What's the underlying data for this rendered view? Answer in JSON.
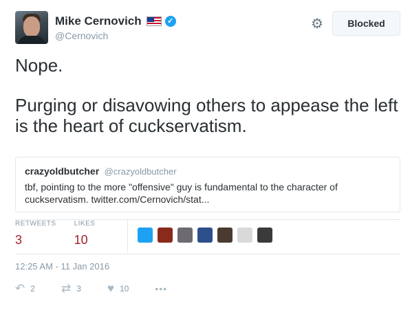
{
  "author": {
    "name": "Mike Cernovich",
    "handle": "@Cernovich",
    "flag_icon": "us-flag-icon",
    "verified_icon": "verified-badge-icon",
    "verified_glyph": "✓"
  },
  "header": {
    "gear_icon": "⚙",
    "blocked_label": "Blocked"
  },
  "tweet": {
    "line1": "Nope.",
    "line2": "Purging or disavowing others to appease the left is the heart of cuckservatism."
  },
  "quoted": {
    "name": "crazyoldbutcher",
    "handle": "@crazyoldbutcher",
    "text": "tbf, pointing to the more \"offensive\" guy is fundamental to the character of cuckservatism. twitter.com/Cernovich/stat..."
  },
  "stats": {
    "retweets_label": "RETWEETS",
    "retweets_value": "3",
    "likes_label": "LIKES",
    "likes_value": "10"
  },
  "likers_colors": [
    "#1da1f2",
    "#8a2a1c",
    "#6d6a70",
    "#2d4f8b",
    "#4a3a2f",
    "#d9d9d9",
    "#3a3a3a"
  ],
  "timestamp": "12:25 AM - 11 Jan 2016",
  "actions": {
    "reply_icon": "↶",
    "reply_count": "2",
    "retweet_icon": "⇄",
    "retweet_count": "3",
    "like_icon": "♥",
    "like_count": "10",
    "more_icon": "•••"
  },
  "colors": {
    "accent": "#1da1f2",
    "stat_value": "#a5202a",
    "muted": "#8899a6"
  }
}
